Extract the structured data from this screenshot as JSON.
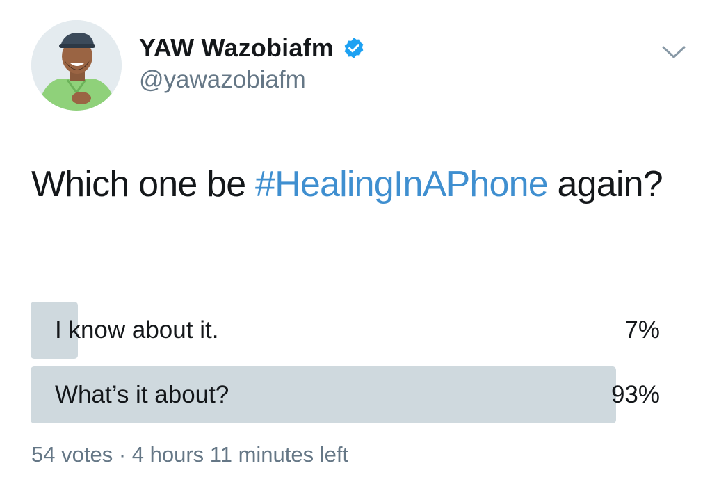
{
  "tweet": {
    "display_name": "YAW Wazobiafm",
    "handle": "@yawazobiafm",
    "verified": true,
    "text_before": "Which one be ",
    "hashtag": "#HealingInAPhone",
    "text_after": " again?",
    "icons": {
      "avatar": "profile-photo",
      "verified": "verified-badge-icon",
      "menu": "chevron-down-icon"
    },
    "colors": {
      "hashtag": "#3f8fd0",
      "verified": "#1da1f2",
      "poll_bar": "#cfd9de",
      "secondary_text": "#657786"
    }
  },
  "poll": {
    "options": [
      {
        "label": "I know about it.",
        "percent_label": "7%",
        "percent": 7
      },
      {
        "label": "What’s it about?",
        "percent_label": "93%",
        "percent": 93
      }
    ],
    "votes": "54 votes",
    "separator": "·",
    "time_left": "4 hours 11 minutes left"
  }
}
